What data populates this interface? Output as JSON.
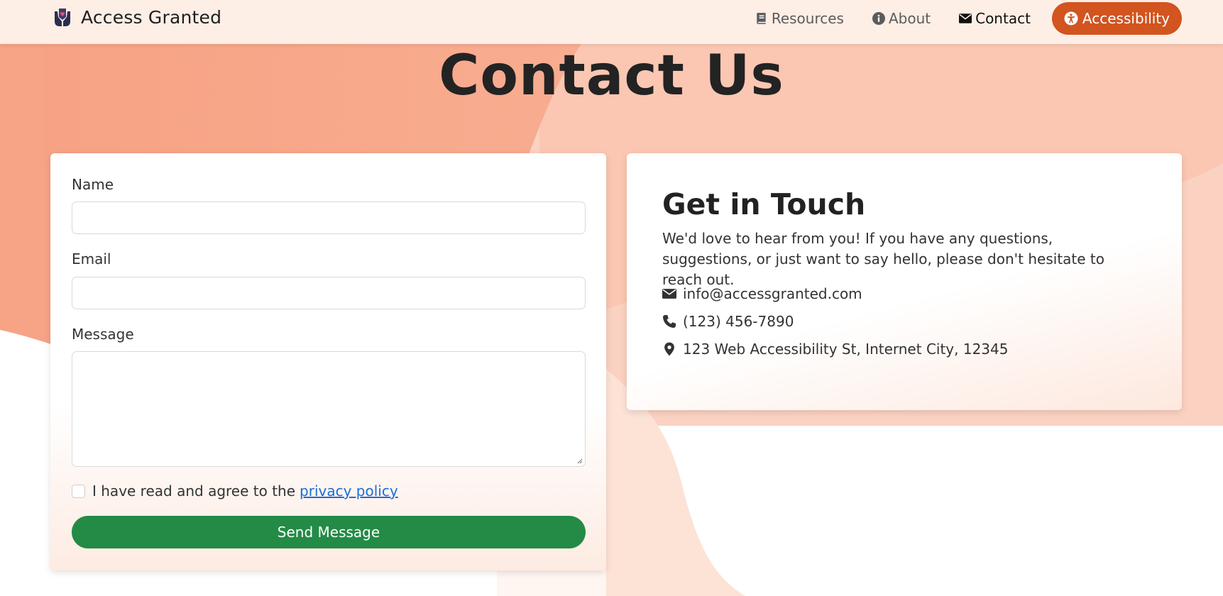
{
  "nav": {
    "brand": "Access Granted",
    "items": [
      {
        "label": "Resources",
        "icon": "book-icon"
      },
      {
        "label": "About",
        "icon": "info-icon"
      },
      {
        "label": "Contact",
        "icon": "envelope-icon",
        "active": true
      }
    ],
    "accessibility_button": "Accessibility"
  },
  "page": {
    "title": "Contact Us"
  },
  "form": {
    "name_label": "Name",
    "email_label": "Email",
    "message_label": "Message",
    "name_value": "",
    "email_value": "",
    "message_value": "",
    "agree_text": "I have read and agree to the",
    "privacy_link": "privacy policy",
    "submit_label": "Send Message"
  },
  "info": {
    "title": "Get in Touch",
    "text": "We'd love to hear from you! If you have any questions, suggestions, or just want to say hello, please don't hesitate to reach out.",
    "email": "info@accessgranted.com",
    "phone": "(123) 456-7890",
    "address": "123 Web Accessibility St, Internet City, 12345"
  },
  "colors": {
    "accent": "#d2541f",
    "submit": "#238b45",
    "link": "#1a6fd6",
    "background_blob": "#f7a585"
  }
}
